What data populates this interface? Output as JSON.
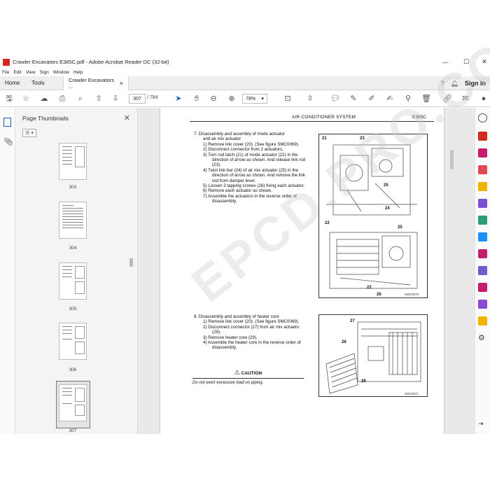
{
  "window": {
    "title": "Crawler Excavators E385C.pdf - Adobe Acrobat Reader DC (32-bit)",
    "minimize": "—",
    "maximize": "☐",
    "close": "✕"
  },
  "menu": [
    "File",
    "Edit",
    "View",
    "Sign",
    "Window",
    "Help"
  ],
  "tabs": {
    "home": "Home",
    "tools": "Tools",
    "document": "Crawler Excavators ...",
    "document_close": "×"
  },
  "account": {
    "sign_in": "Sign In"
  },
  "toolbar": {
    "current_page": "307",
    "total_pages": "/ 784",
    "zoom": "78%",
    "zoom_dropdown": "▾"
  },
  "thumbnails": {
    "title": "Page Thumbnails",
    "close": "✕",
    "options": "☰ ▾",
    "pages": [
      "303",
      "304",
      "305",
      "306",
      "307"
    ],
    "selected": "307"
  },
  "document": {
    "header_title": "AIR CONDITIONER SYSTEM",
    "header_model": "E385C",
    "step7_title": "7.   Disassembly and assembly of mode actuator",
    "step7_title2": "and air mix actuator",
    "step7_items": [
      "1) Remove link cover (20). (See figure SMC0069).",
      "2) Disconnect connector from 2 actuators.",
      "3) Turn rod latch (21) of mode actuator (22) in the direction of arrow as shown. And release link rod (23).",
      "4) Twist link bar (24) of air mix actuator (25) in the direction of arrow as shown. And remove the link rod from damper lever.",
      "5) Loosen 3 tapping screws (26) fixing each actuator.",
      "6) Remove each actuator as shown.",
      "7) Assemble the actuators in the reverse order of disassembly."
    ],
    "step8_title": "8.   Disassembly and assembly of heater core",
    "step8_items": [
      "1) Remove link cover (20). (See figure SMC0069).",
      "2) Disconnect connector (27) from air mix actuator (28).",
      "3) Remove heater core (29).",
      "4) Assemble the heater core in the reverse order of disassembly."
    ],
    "caution_title": "CAUTION",
    "caution_text": "Do not exert excessive load on piping.",
    "fig1_labels": [
      "21",
      "23",
      "25",
      "24",
      "22",
      "25",
      "22",
      "26"
    ],
    "fig1_code": "SMC0070",
    "fig2_labels": [
      "27",
      "28",
      "29"
    ],
    "fig2_code": "SMC0071",
    "watermark": "EPCD.PRO.COM"
  },
  "colors": {
    "acrobat_red": "#d42a1e",
    "panel_bg": "#f4f4f4",
    "doc_bg": "#e9e9e9",
    "toolbar_icon": "#555555"
  }
}
